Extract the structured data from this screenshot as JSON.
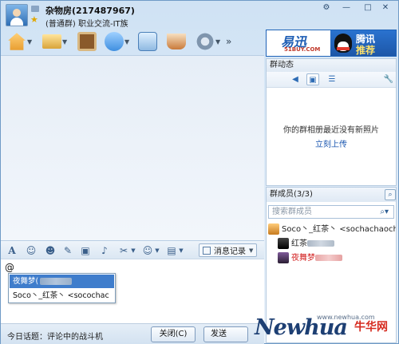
{
  "window": {
    "group_name": "杂物房(217487967)",
    "group_desc": "(普通群) 职业交流-IT族",
    "controls": {
      "settings": "⚙",
      "minimize": "—",
      "maximize": "□",
      "close": "✕"
    }
  },
  "toolbar": {
    "items": [
      {
        "icon": "home-icon"
      },
      {
        "icon": "folder-icon"
      },
      {
        "icon": "album-icon"
      },
      {
        "icon": "microphone-icon"
      },
      {
        "icon": "group-chat-icon"
      },
      {
        "icon": "coffee-cup-icon"
      },
      {
        "icon": "gear-icon"
      }
    ],
    "more": "»"
  },
  "ad": {
    "brand": "易迅",
    "url": "51BUY.COM",
    "text_line1": "腾讯",
    "text_line2": "推荐"
  },
  "group_news": {
    "title": "群动态",
    "empty_message": "你的群相册最近没有新照片",
    "upload_link": "立刻上传"
  },
  "members": {
    "title": "群成员(3/3)",
    "search_placeholder": "搜索群成员",
    "list": [
      {
        "name": "Soco丶_红茶丶 <sochachaocha"
      },
      {
        "name": "红茶"
      },
      {
        "name": "夜舞梦"
      }
    ]
  },
  "input_toolbar": {
    "font_icon": "A",
    "smile_icon": "☺",
    "history_label": "消息记录"
  },
  "input": {
    "text": "@",
    "mention_suggestions": [
      {
        "name": "夜舞梦("
      },
      {
        "name": "Soco丶_红茶丶 <socochac"
      }
    ]
  },
  "bottom": {
    "topic": "今日话题：评论中的战斗机",
    "close_label": "关闭(C)",
    "send_label": "发送"
  },
  "watermark": {
    "text_en": "Newhua",
    "text_cn": "牛华网",
    "url": "www.newhua.com"
  },
  "colors": {
    "accent": "#1f63b8",
    "selection": "#3f7dcc",
    "highlight_member": "#d21e1e"
  }
}
